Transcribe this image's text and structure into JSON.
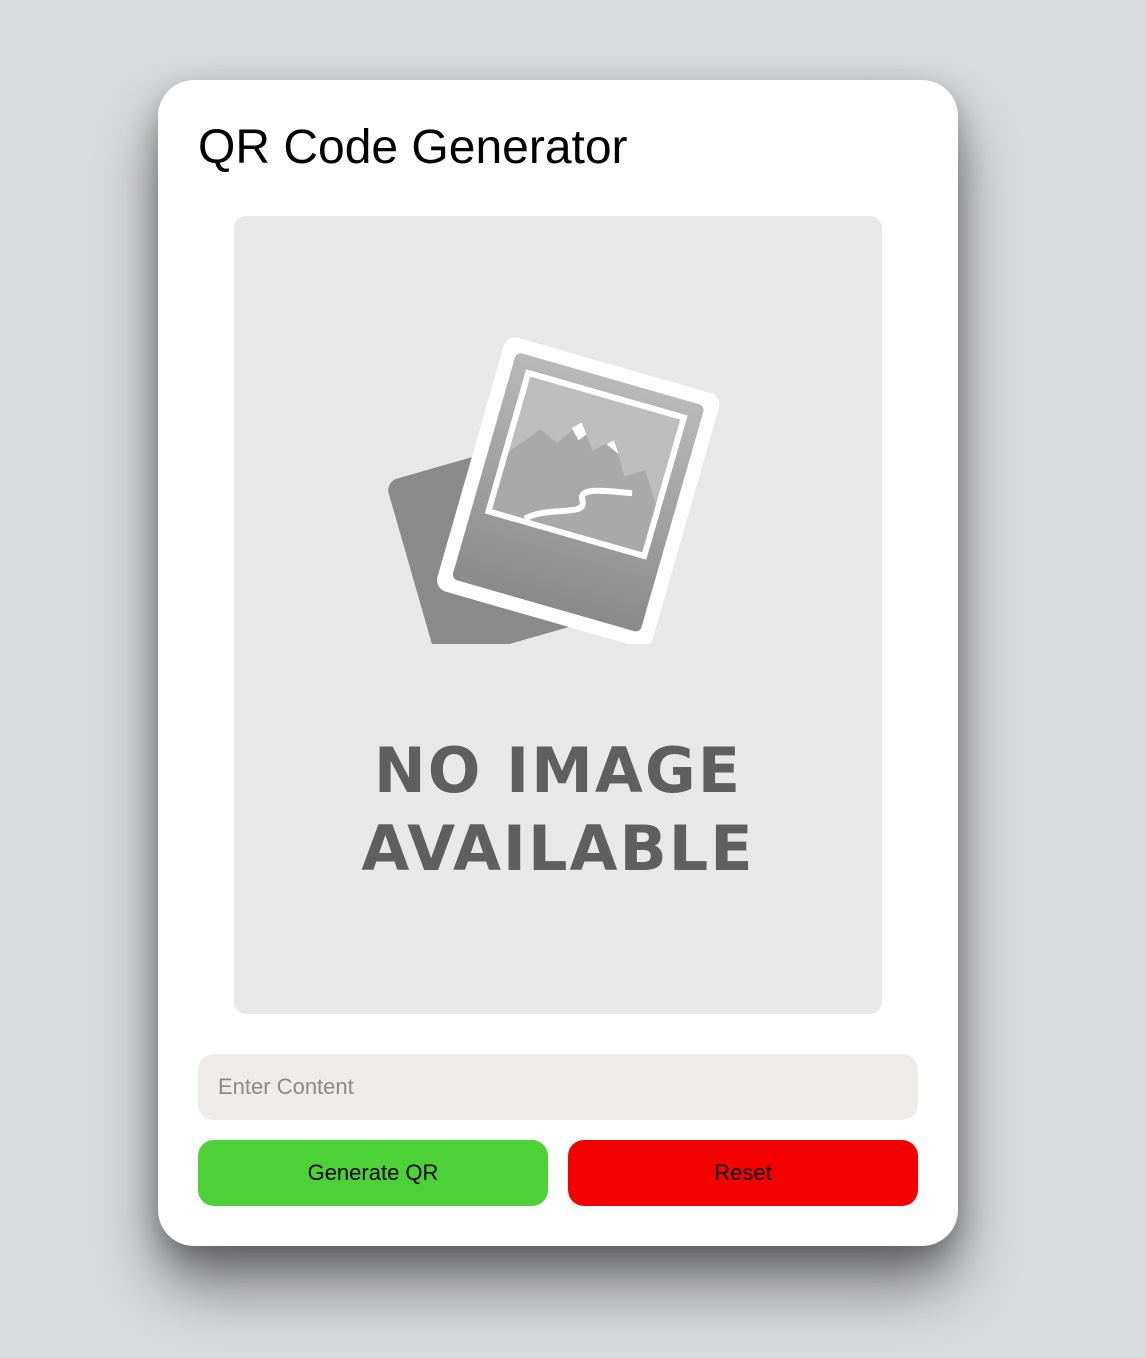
{
  "app": {
    "title": "QR Code Generator"
  },
  "preview": {
    "icon": "no-image-photo-icon",
    "placeholder_line1": "NO IMAGE",
    "placeholder_line2": "AVAILABLE"
  },
  "form": {
    "content_value": "",
    "content_placeholder": "Enter Content"
  },
  "buttons": {
    "generate_label": "Generate QR",
    "reset_label": "Reset"
  },
  "colors": {
    "generate": "#4cd137",
    "reset": "#f40000",
    "input_bg": "#f0ebeb",
    "preview_bg": "#e8e8e8",
    "page_bg": "#d9dadd"
  }
}
